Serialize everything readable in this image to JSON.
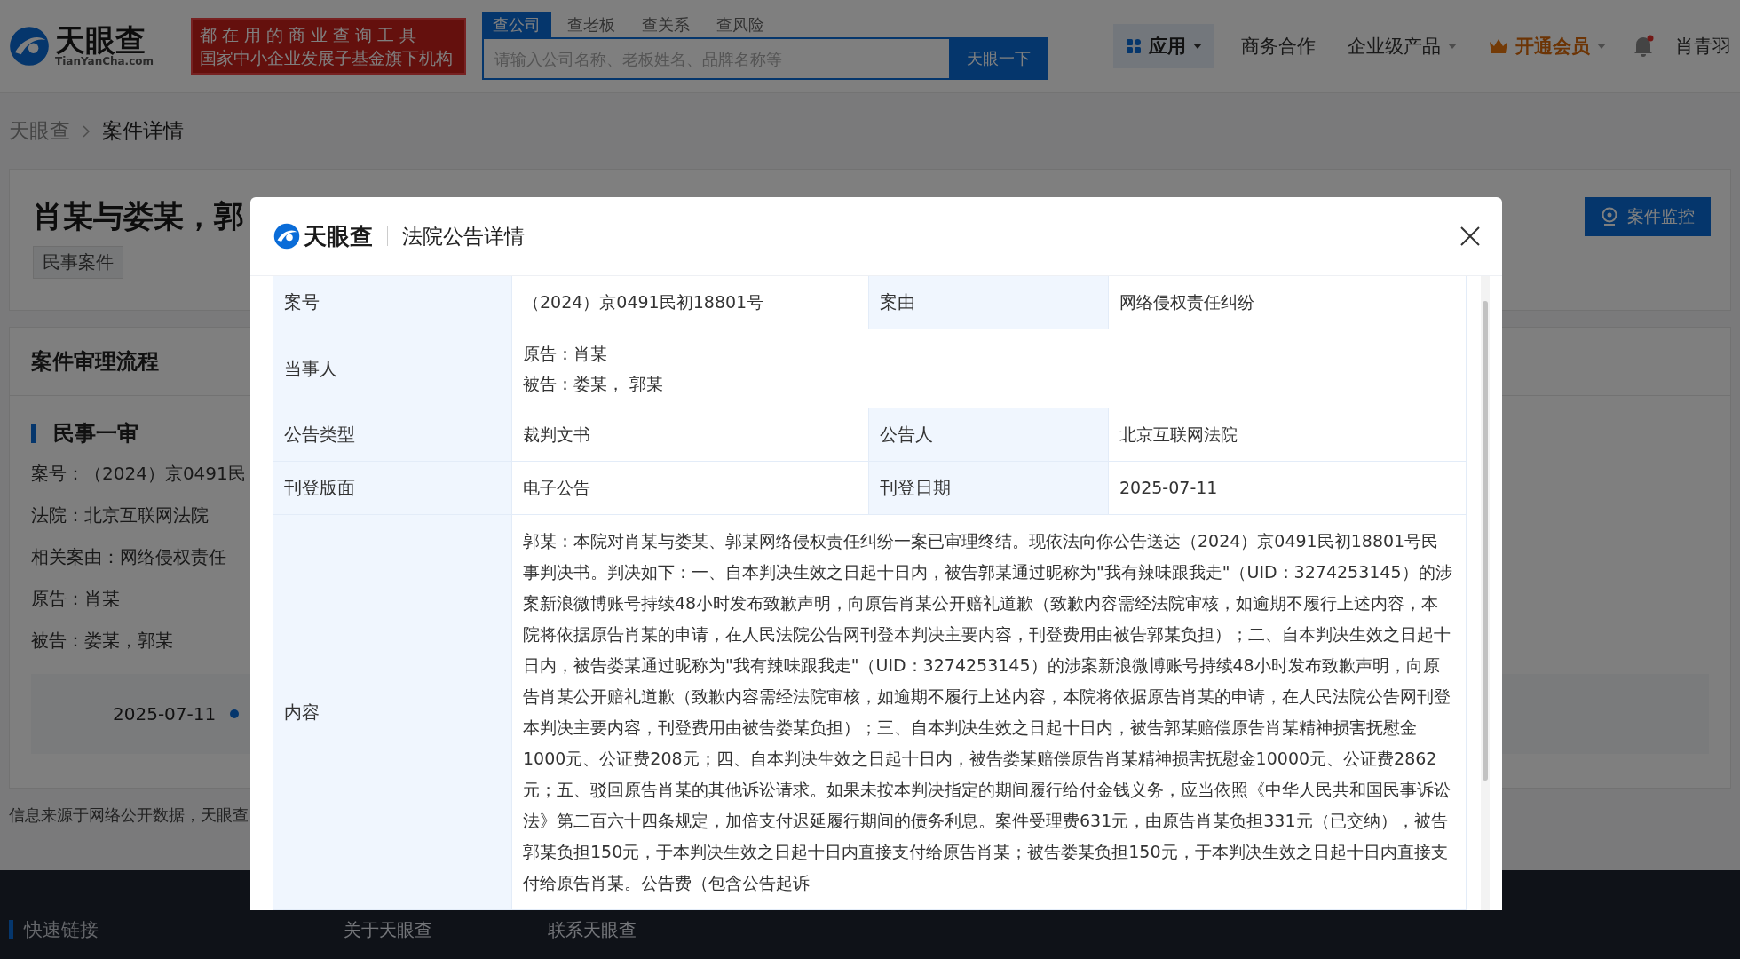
{
  "header": {
    "logo": {
      "name": "天眼查",
      "domain": "TianYanCha.com"
    },
    "slogan": [
      "都在用的商业查询工具",
      "国家中小企业发展子基金旗下机构"
    ],
    "search_tabs": [
      {
        "label": "查公司",
        "selected": true
      },
      {
        "label": "查老板",
        "selected": false
      },
      {
        "label": "查关系",
        "selected": false
      },
      {
        "label": "查风险",
        "selected": false
      }
    ],
    "search": {
      "placeholder": "请输入公司名称、老板姓名、品牌名称等",
      "button": "天眼一下"
    },
    "nav": [
      {
        "label": "应用",
        "kind": "apps"
      },
      {
        "label": "商务合作",
        "kind": "link"
      },
      {
        "label": "企业级产品",
        "kind": "dropdown"
      },
      {
        "label": "开通会员",
        "kind": "vip"
      }
    ],
    "notifications": {
      "unread": true
    },
    "user": "肖青羽"
  },
  "breadcrumb": [
    "天眼查",
    "案件详情"
  ],
  "case": {
    "title": "肖某与娄某，郭",
    "tag": "民事案件",
    "monitor_button": "案件监控"
  },
  "process": {
    "title": "案件审理流程",
    "stage": "民事一审",
    "fields": [
      {
        "label": "案号：",
        "value": "（2024）京0491民"
      },
      {
        "label": "法院：",
        "value": "北京互联网法院"
      },
      {
        "label": "相关案由：",
        "value": "网络侵权责任"
      },
      {
        "label": "原告：",
        "value": "肖某"
      },
      {
        "label": "被告：",
        "value": "娄某，郭某"
      }
    ],
    "timeline": [
      {
        "date": "2025-07-11"
      }
    ]
  },
  "source_note": "信息来源于网络公开数据，天眼查",
  "footer": {
    "title": "快速链接",
    "links": [
      "关于天眼查",
      "联系天眼查"
    ]
  },
  "modal": {
    "logo": "天眼查",
    "title": "法院公告详情",
    "rows": [
      {
        "cells": [
          {
            "label": "案号",
            "value": "（2024）京0491民初18801号"
          },
          {
            "label": "案由",
            "value": "网络侵权责任纠纷"
          }
        ]
      },
      {
        "cells": [
          {
            "label": "当事人",
            "lines": [
              "原告：肖某",
              "被告：娄某， 郭某"
            ]
          }
        ]
      },
      {
        "cells": [
          {
            "label": "公告类型",
            "value": "裁判文书"
          },
          {
            "label": "公告人",
            "value": "北京互联网法院"
          }
        ]
      },
      {
        "cells": [
          {
            "label": "刊登版面",
            "value": "电子公告"
          },
          {
            "label": "刊登日期",
            "value": "2025-07-11"
          }
        ]
      },
      {
        "cells": [
          {
            "label": "内容",
            "value": "郭某：本院对肖某与娄某、郭某网络侵权责任纠纷一案已审理终结。现依法向你公告送达（2024）京0491民初18801号民事判决书。判决如下：一、自本判决生效之日起十日内，被告郭某通过昵称为\"我有辣味跟我走\"（UID：3274253145）的涉案新浪微博账号持续48小时发布致歉声明，向原告肖某公开赔礼道歉（致歉内容需经法院审核，如逾期不履行上述内容，本院将依据原告肖某的申请，在人民法院公告网刊登本判决主要内容，刊登费用由被告郭某负担）；二、自本判决生效之日起十日内，被告娄某通过昵称为\"我有辣味跟我走\"（UID：3274253145）的涉案新浪微博账号持续48小时发布致歉声明，向原告肖某公开赔礼道歉（致歉内容需经法院审核，如逾期不履行上述内容，本院将依据原告肖某的申请，在人民法院公告网刊登本判决主要内容，刊登费用由被告娄某负担）；三、自本判决生效之日起十日内，被告郭某赔偿原告肖某精神损害抚慰金1000元、公证费208元；四、自本判决生效之日起十日内，被告娄某赔偿原告肖某精神损害抚慰金10000元、公证费2862元；五、驳回原告肖某的其他诉讼请求。如果未按本判决指定的期间履行给付金钱义务，应当依照《中华人民共和国民事诉讼法》第二百六十四条规定，加倍支付迟延履行期间的债务利息。案件受理费631元，由原告肖某负担331元（已交纳），被告郭某负担150元，于本判决生效之日起十日内直接支付给原告肖某；被告娄某负担150元，于本判决生效之日起十日内直接支付给原告肖某。公告费（包含公告起诉"
          }
        ]
      }
    ]
  }
}
